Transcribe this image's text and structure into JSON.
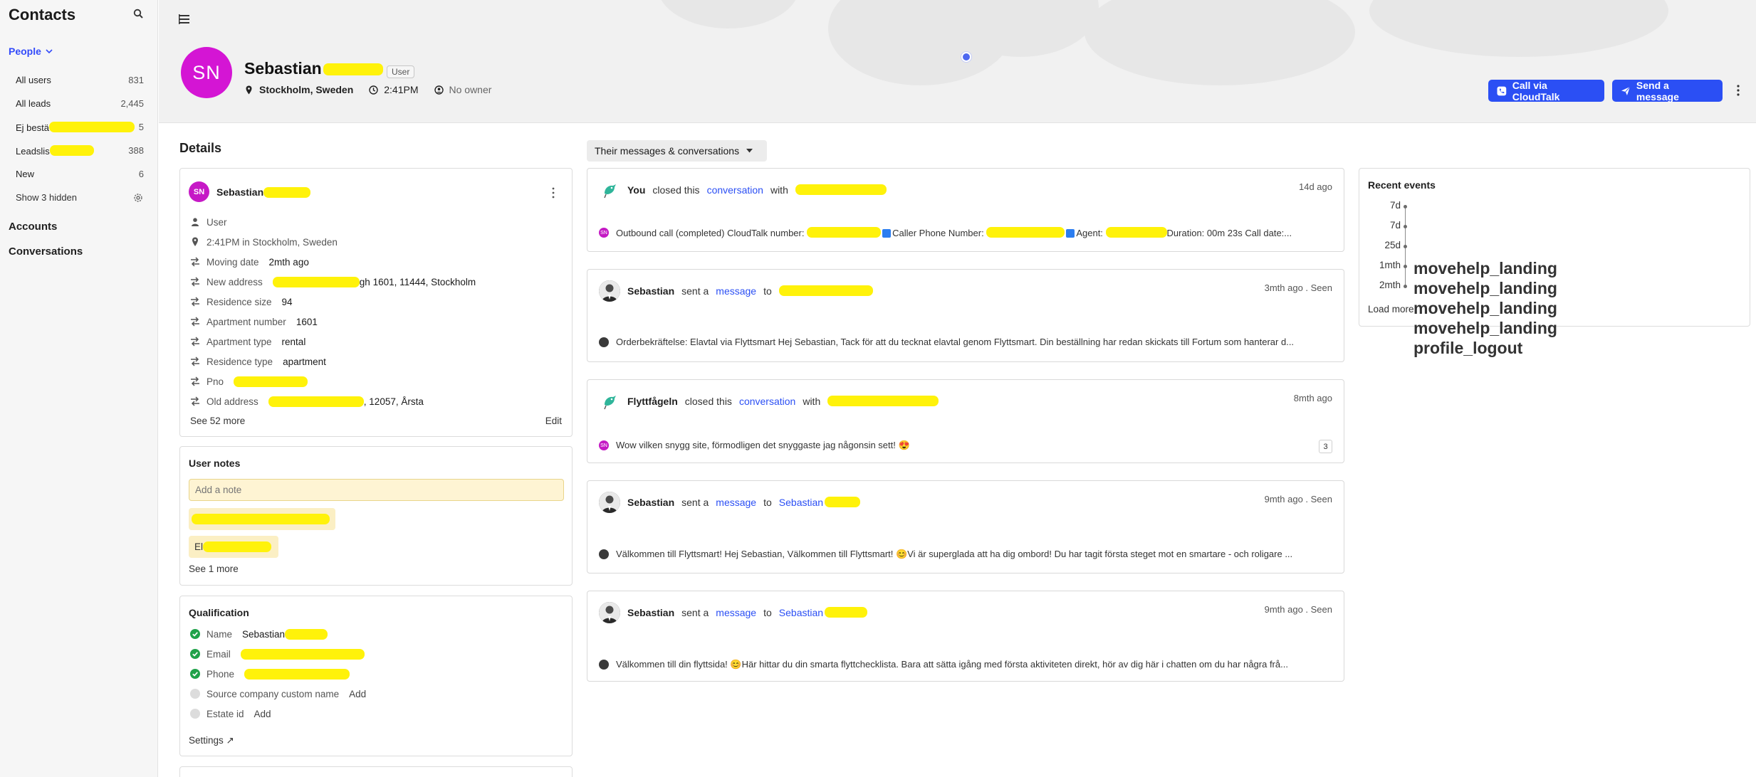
{
  "sidebar": {
    "title": "Contacts",
    "section": "People",
    "items": [
      {
        "label": "All users",
        "count": "831"
      },
      {
        "label": "All leads",
        "count": "2,445"
      },
      {
        "label": "Ej bestä",
        "count": "5"
      },
      {
        "label": "Leadslis",
        "count": "388"
      },
      {
        "label": "New",
        "count": "6"
      }
    ],
    "show_hidden": "Show 3 hidden",
    "accounts": "Accounts",
    "conversations": "Conversations"
  },
  "header": {
    "initials": "SN",
    "first_name": "Sebastian",
    "role": "User",
    "location": "Stockholm, Sweden",
    "time": "2:41PM",
    "owner": "No owner",
    "call_button": "Call via CloudTalk",
    "send_button": "Send a message"
  },
  "details": {
    "title": "Details",
    "name": "Sebastian",
    "attributes": [
      {
        "label": "User",
        "value": ""
      },
      {
        "label": "2:41PM in Stockholm, Sweden",
        "value": ""
      },
      {
        "label": "Moving date",
        "value": "2mth ago"
      },
      {
        "label": "New address",
        "value": "gh 1601, 11444, Stockholm"
      },
      {
        "label": "Residence size",
        "value": "94"
      },
      {
        "label": "Apartment number",
        "value": "1601"
      },
      {
        "label": "Apartment type",
        "value": "rental"
      },
      {
        "label": "Residence type",
        "value": "apartment"
      },
      {
        "label": "Pno",
        "value": ""
      },
      {
        "label": "Old address",
        "value": ", 12057, Årsta"
      }
    ],
    "see_more": "See 52 more",
    "edit": "Edit"
  },
  "notes": {
    "title": "User notes",
    "placeholder": "Add a note",
    "chips": [
      "",
      "El"
    ],
    "see_more": "See 1 more"
  },
  "qualification": {
    "title": "Qualification",
    "rows": [
      {
        "label": "Name",
        "value": "Sebastian",
        "status": "done"
      },
      {
        "label": "Email",
        "value": "",
        "status": "done"
      },
      {
        "label": "Phone",
        "value": "",
        "status": "done"
      },
      {
        "label": "Source company custom name",
        "value": "Add",
        "status": "empty"
      },
      {
        "label": "Estate id",
        "value": "Add",
        "status": "empty"
      }
    ],
    "settings": "Settings ↗"
  },
  "filter": {
    "label": "Their messages & conversations"
  },
  "conversations": [
    {
      "actor": "You",
      "verb": "closed this",
      "link": "conversation",
      "prep": "with",
      "target": "",
      "time": "14d ago",
      "body_a": "Outbound call (completed) CloudTalk number: ",
      "body_b": "Caller Phone Number: ",
      "body_c": "Agent: ",
      "body_d": "Duration: 00m 23s Call date:..."
    },
    {
      "actor": "Sebastian",
      "verb": "sent a",
      "link": "message",
      "prep": "to",
      "target": "",
      "time": "3mth ago . Seen",
      "body": "Orderbekräftelse: Elavtal via Flyttsmart Hej Sebastian, Tack för att du tecknat elavtal genom Flyttsmart. Din beställning har redan skickats till Fortum som hanterar d..."
    },
    {
      "actor": "Flyttfågeln",
      "verb": "closed this",
      "link": "conversation",
      "prep": "with",
      "target": "",
      "time": "8mth ago",
      "body": "Wow vilken snygg site, förmodligen det snyggaste jag någonsin sett! 😍",
      "count": "3"
    },
    {
      "actor": "Sebastian",
      "verb": "sent a",
      "link": "message",
      "prep": "to",
      "target": "Sebastian",
      "time": "9mth ago . Seen",
      "body": "Välkommen till Flyttsmart! Hej Sebastian, Välkommen till Flyttsmart! 😊Vi är superglada att ha dig ombord! Du har tagit första steget mot en smartare - och roligare ..."
    },
    {
      "actor": "Sebastian",
      "verb": "sent a",
      "link": "message",
      "prep": "to",
      "target": "Sebastian",
      "time": "9mth ago . Seen",
      "body": "Välkommen till din flyttsida! 😊Här hittar du din smarta flyttchecklista. Bara att sätta igång med första aktiviteten direkt, hör av dig här i chatten om du har några frå..."
    }
  ],
  "events": {
    "title": "Recent events",
    "items": [
      {
        "ago": "7d",
        "name": "movehelp_landing"
      },
      {
        "ago": "7d",
        "name": "movehelp_landing"
      },
      {
        "ago": "25d",
        "name": "movehelp_landing"
      },
      {
        "ago": "1mth",
        "name": "movehelp_landing"
      },
      {
        "ago": "2mth",
        "name": "profile_logout"
      }
    ],
    "load_more": "Load more"
  },
  "colors": {
    "accent": "#2b4ff4",
    "avatar": "#d415d4",
    "note_bg": "#fbefc4",
    "check": "#20a24a"
  }
}
